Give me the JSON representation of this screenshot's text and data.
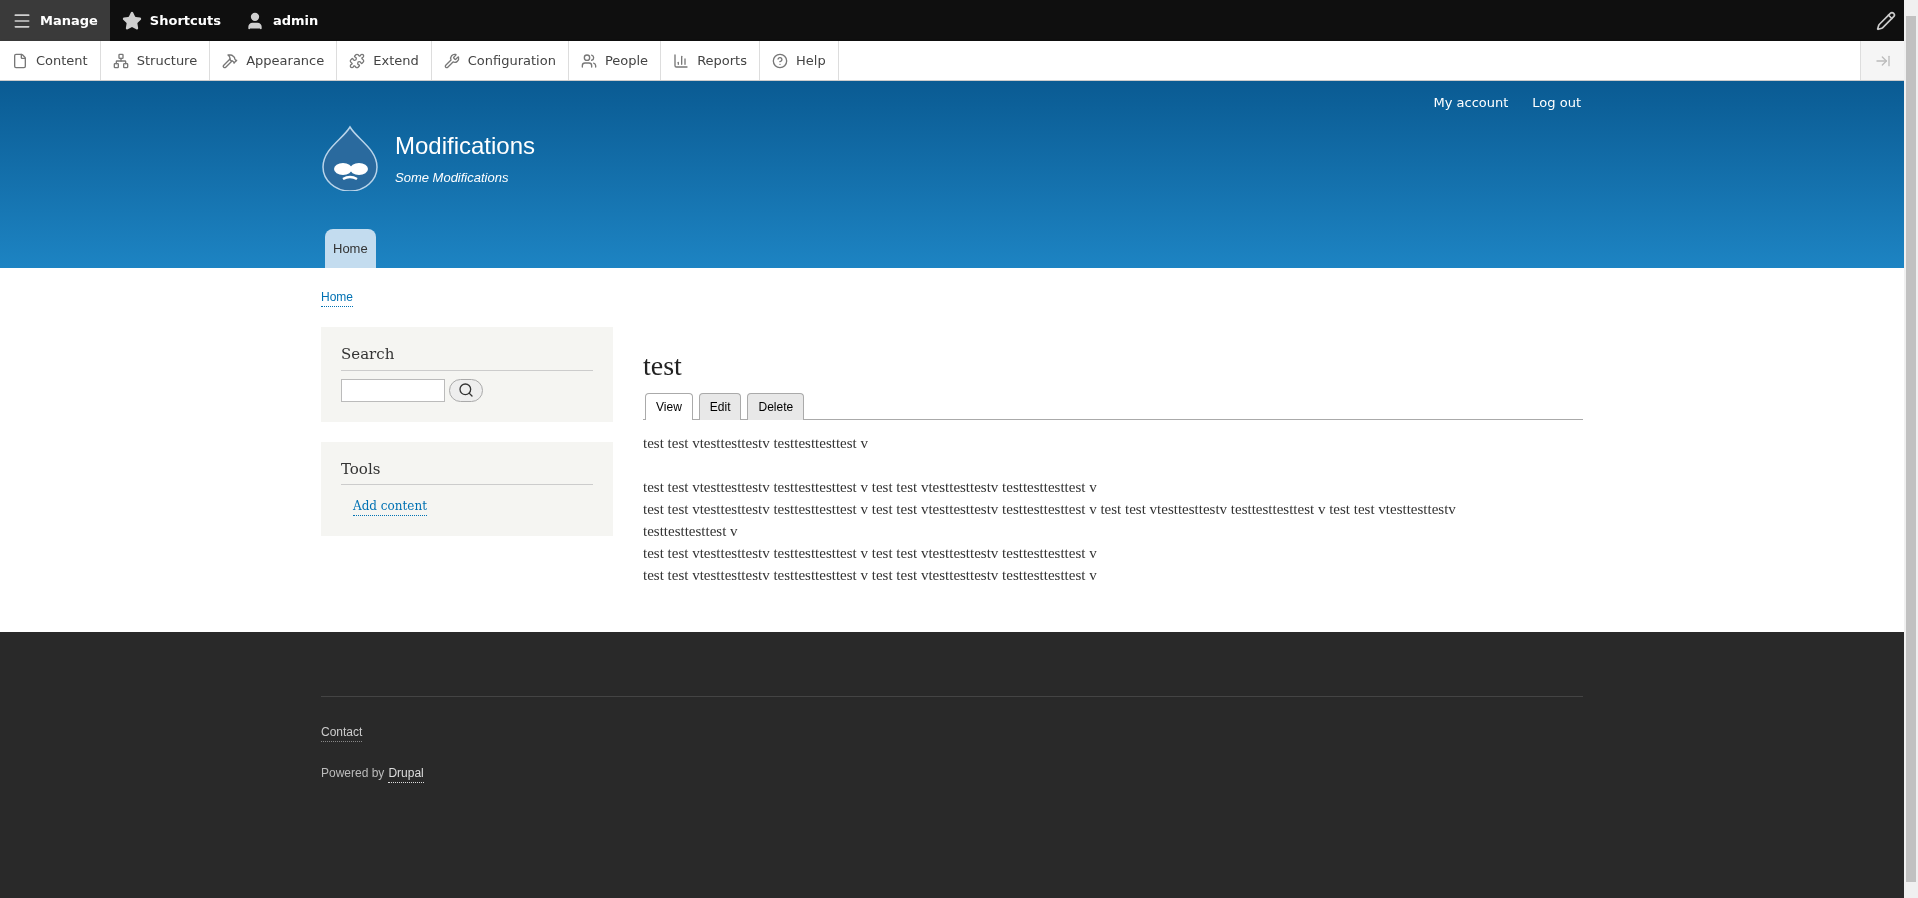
{
  "toolbar": {
    "items": [
      {
        "kind": "menu",
        "label": "Manage",
        "selected": true
      },
      {
        "kind": "star",
        "label": "Shortcuts",
        "selected": false
      },
      {
        "kind": "user",
        "label": "admin",
        "selected": false
      }
    ]
  },
  "admin_menu": [
    {
      "kind": "content",
      "label": "Content"
    },
    {
      "kind": "structure",
      "label": "Structure"
    },
    {
      "kind": "appearance",
      "label": "Appearance"
    },
    {
      "kind": "extend",
      "label": "Extend"
    },
    {
      "kind": "configuration",
      "label": "Configuration"
    },
    {
      "kind": "people",
      "label": "People"
    },
    {
      "kind": "reports",
      "label": "Reports"
    },
    {
      "kind": "help",
      "label": "Help"
    }
  ],
  "header": {
    "account_links": [
      "My account",
      "Log out"
    ],
    "site_name": "Modifications",
    "slogan": "Some Modifications",
    "nav": [
      {
        "label": "Home",
        "selected": true
      }
    ]
  },
  "breadcrumb": [
    "Home"
  ],
  "sidebar": {
    "search": {
      "title": "Search"
    },
    "tools": {
      "title": "Tools",
      "links": [
        "Add content"
      ]
    }
  },
  "main": {
    "title": "test",
    "tabs": [
      {
        "label": "View",
        "selected": true
      },
      {
        "label": "Edit",
        "selected": false
      },
      {
        "label": "Delete",
        "selected": false
      }
    ],
    "paragraphs": [
      [
        "test test vtesttesttestv testtesttesttest v"
      ],
      [
        "test test vtesttesttestv testtesttesttest v test test vtesttesttestv testtesttesttest v",
        "test test vtesttesttestv testtesttesttest v test test vtesttesttestv testtesttesttest v test test vtesttesttestv testtesttesttest v test test vtesttesttestv testtesttesttest v",
        "test test vtesttesttestv testtesttesttest v test test vtesttesttestv testtesttesttest v",
        "test test vtesttesttestv testtesttesttest v test test vtesttesttestv testtesttesttest v"
      ]
    ]
  },
  "footer": {
    "links": [
      "Contact"
    ],
    "powered_by": {
      "text": "Powered by",
      "link": "Drupal"
    }
  }
}
